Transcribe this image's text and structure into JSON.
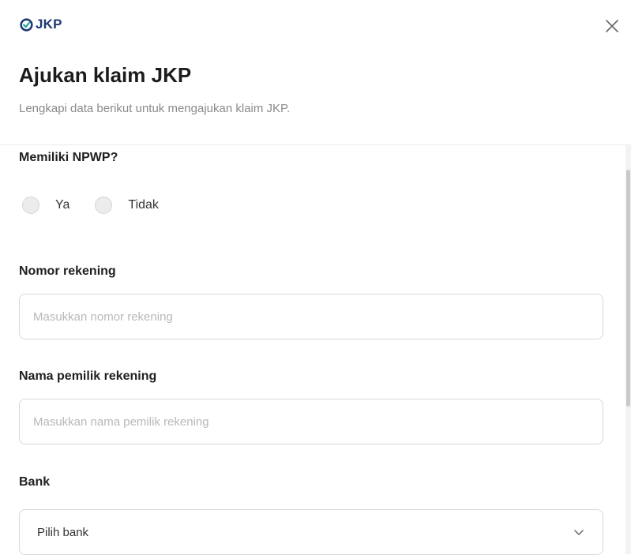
{
  "header": {
    "logo_text": "JKP",
    "close_icon": "close-icon"
  },
  "title": "Ajukan klaim JKP",
  "subtitle": "Lengkapi data berikut untuk mengajukan klaim JKP.",
  "form": {
    "npwp": {
      "label": "Memiliki NPWP?",
      "options": [
        {
          "label": "Ya",
          "selected": false
        },
        {
          "label": "Tidak",
          "selected": false
        }
      ]
    },
    "account_number": {
      "label": "Nomor rekening",
      "value": "",
      "placeholder": "Masukkan nomor rekening"
    },
    "account_name": {
      "label": "Nama pemilik rekening",
      "value": "",
      "placeholder": "Masukkan nama pemilik rekening"
    },
    "bank": {
      "label": "Bank",
      "selected_value": "Pilih bank",
      "icon": "chevron-down-icon"
    }
  },
  "colors": {
    "brand": "#1e3a73",
    "brand_accent": "#19a7a0",
    "subtitle": "#8a8a8a",
    "border": "#d9d9d9"
  }
}
